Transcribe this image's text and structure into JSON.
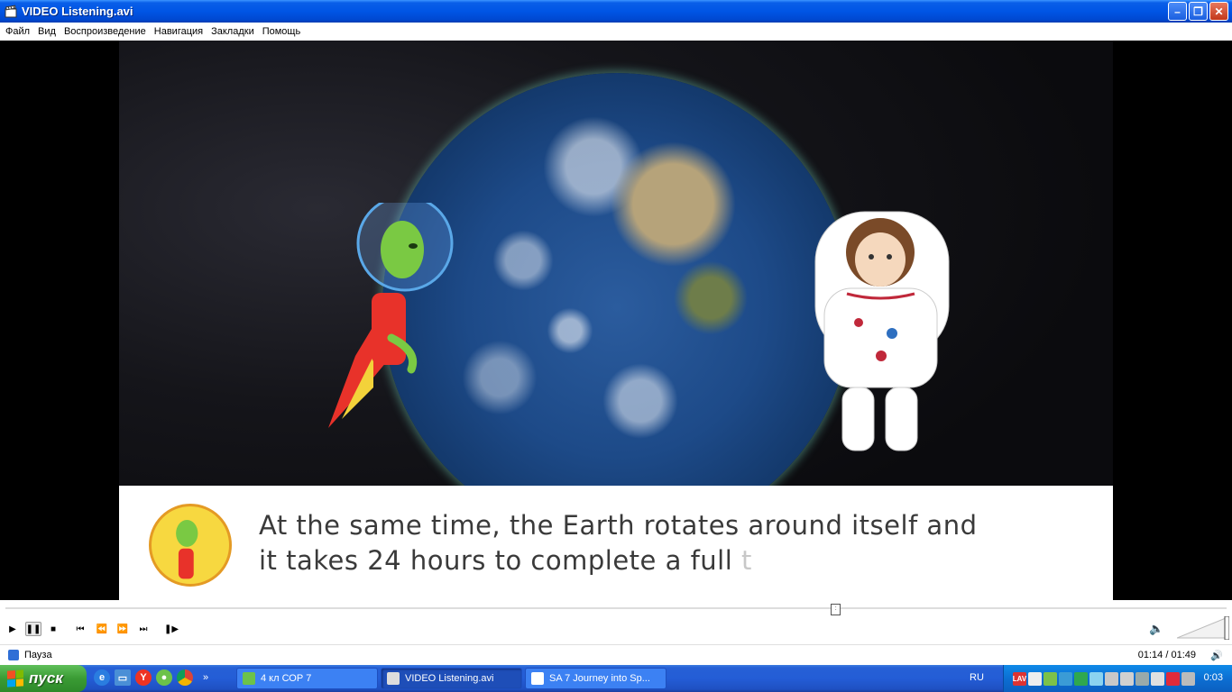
{
  "window": {
    "title": "VIDEO Listening.avi"
  },
  "menu": [
    "Файл",
    "Вид",
    "Воспроизведение",
    "Навигация",
    "Закладки",
    "Помощь"
  ],
  "video": {
    "subtitle_line1": "At the same time, the Earth rotates around itself and",
    "subtitle_line2": "it takes 24 hours to complete a full ",
    "subtitle_faded": "t"
  },
  "player": {
    "progress_fraction": 0.68,
    "volume_fraction": 1.0
  },
  "status": {
    "state": "Пауза",
    "timecode": "01:14 / 01:49"
  },
  "taskbar": {
    "start_label": "пуск",
    "tasks": [
      {
        "label": "4 кл СОР 7",
        "active": false
      },
      {
        "label": "VIDEO Listening.avi",
        "active": true
      },
      {
        "label": "SA 7 Journey into Sp...",
        "active": false
      }
    ],
    "language": "RU",
    "tray": {
      "lav_label": "LAV",
      "clock": "0:03"
    }
  },
  "colors": {
    "title_bar": "#0055e5",
    "start_button": "#3a9b34",
    "tray": "#0c6fd3",
    "subtitle_text": "#3a3a3a"
  }
}
